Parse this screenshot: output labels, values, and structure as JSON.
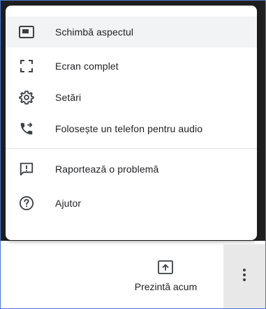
{
  "menu": {
    "items": [
      {
        "label": "Schimbă aspectul",
        "icon": "change-layout-icon",
        "active": true
      },
      {
        "label": "Ecran complet",
        "icon": "fullscreen-icon"
      },
      {
        "label": "Setări",
        "icon": "settings-gear-icon"
      },
      {
        "label": "Folosește un telefon pentru audio",
        "icon": "phone-forward-icon"
      },
      {
        "label": "Raportează o problemă",
        "icon": "report-problem-icon"
      },
      {
        "label": "Ajutor",
        "icon": "help-icon"
      }
    ]
  },
  "toolbar": {
    "present_label": "Prezintă acum",
    "present_icon": "present-screen-icon",
    "more_icon": "more-vert-icon"
  },
  "colors": {
    "icon": "#3c4043",
    "text": "#202124",
    "hover": "#f1f3f4",
    "backdrop": "#1f1f1f",
    "frame": "#4a78c6"
  }
}
